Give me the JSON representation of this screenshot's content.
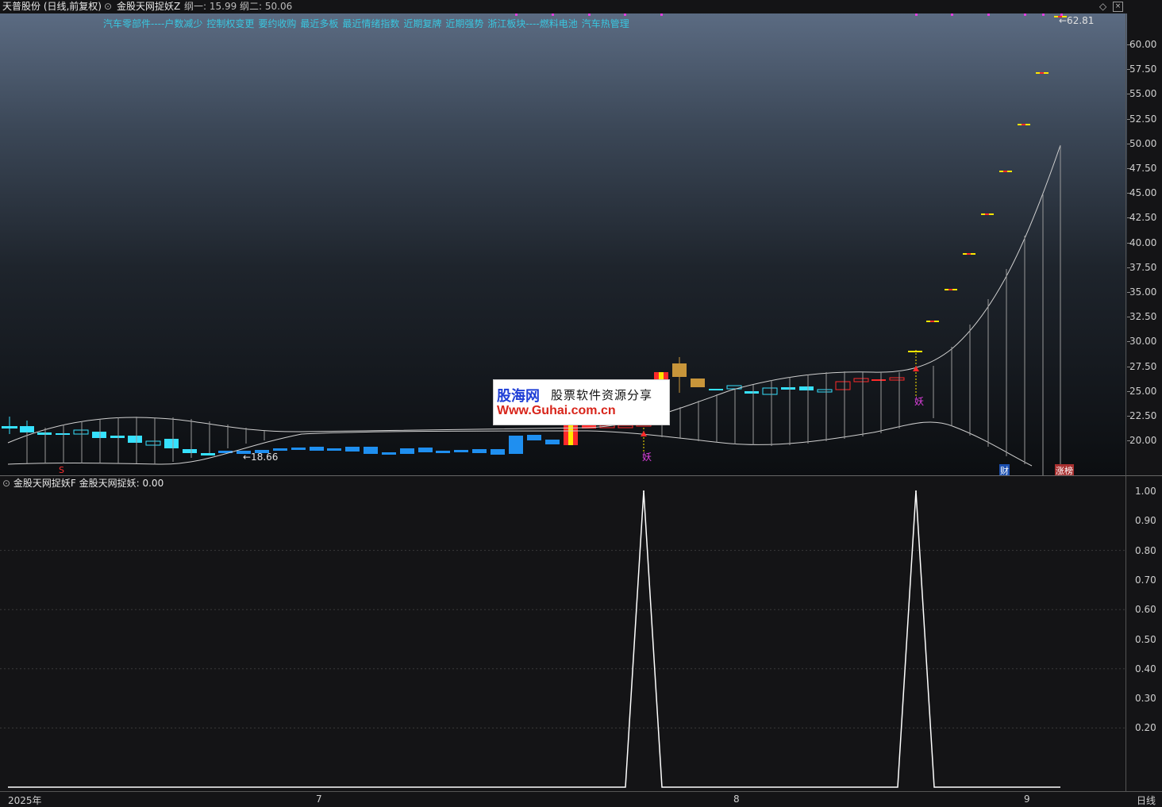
{
  "header": {
    "stock": "天普股份 (日线,前复权)",
    "indicator": "金股天网捉妖Z",
    "params": "纲一: 15.99 纲二: 50.06"
  },
  "concepts": [
    "汽车零部件----户数减少",
    "控制权变更",
    "要约收购",
    "最近多板",
    "最近情绪指数",
    "近期复牌",
    "近期强势",
    "浙江板块----燃料电池",
    "汽车热管理"
  ],
  "main_axis": [
    "60.00",
    "57.50",
    "55.00",
    "52.50",
    "50.00",
    "47.50",
    "45.00",
    "42.50",
    "40.00",
    "37.50",
    "35.00",
    "32.50",
    "30.00",
    "27.50",
    "25.00",
    "22.50",
    "20.00"
  ],
  "annotations": {
    "low_price": "←18.66",
    "high_price": "←62.81",
    "yao_1": "妖",
    "yao_2": "妖",
    "s_marker": "S",
    "cai_marker": "财",
    "zhangbang_marker": "涨榜"
  },
  "sub_header": {
    "name": "金股天网捉妖F",
    "value": "金股天网捉妖: 0.00"
  },
  "sub_axis": [
    "1.00",
    "0.90",
    "0.80",
    "0.70",
    "0.60",
    "0.50",
    "0.40",
    "0.30",
    "0.20"
  ],
  "x_axis": [
    "2025年",
    "7",
    "8",
    "9"
  ],
  "period_button": "日线",
  "watermark": {
    "brand": "股海网",
    "tagline": "股票软件资源分享",
    "url": "Www.Guhai.com.cn"
  },
  "colors": {
    "up": "#ff2a2a",
    "down": "#36e1ff",
    "down_solid": "#1f8ff0",
    "limit_yellow": "#ffe600",
    "gold": "#c8953a",
    "signal": "#ffffff",
    "magenta": "#e040e0",
    "accent": "#39c7e0"
  },
  "chart_data": {
    "type": "line",
    "title": "金股天网捉妖",
    "signal_peaks": [
      {
        "position": "first",
        "value": 1.0
      },
      {
        "position": "second",
        "value": 1.0
      }
    ],
    "ylim": [
      0,
      1.0
    ],
    "price_range": [
      18.66,
      62.81
    ]
  }
}
